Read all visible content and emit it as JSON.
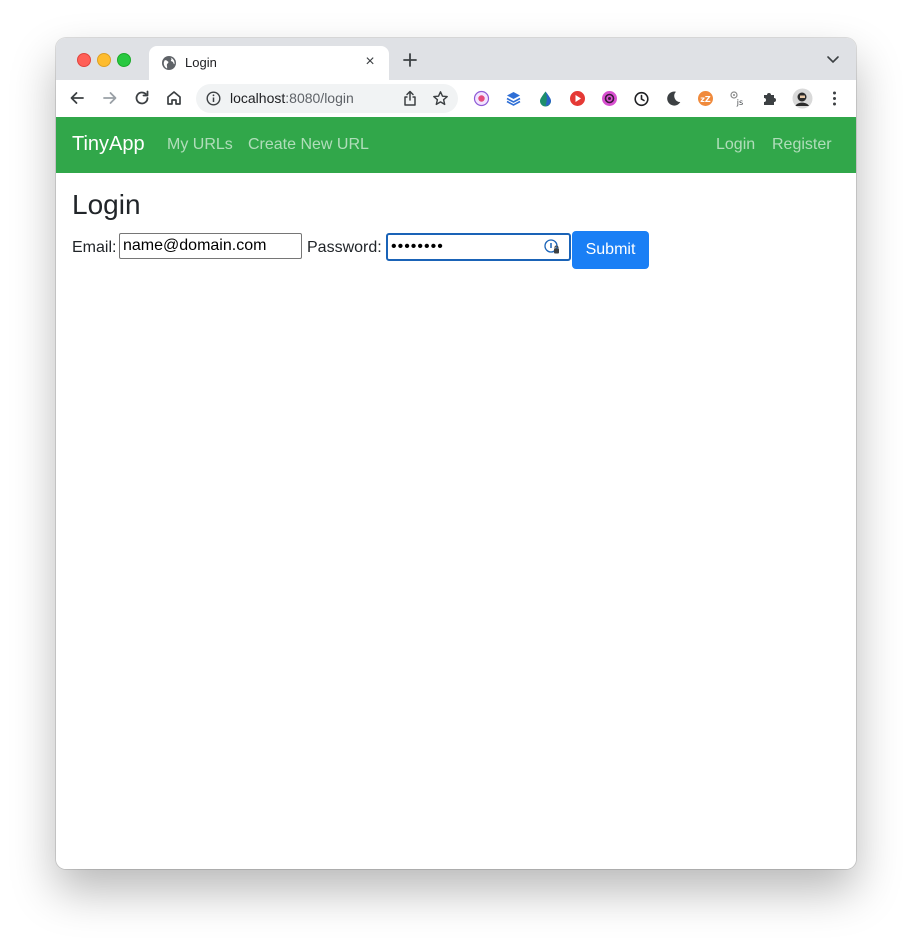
{
  "browser": {
    "tab": {
      "title": "Login",
      "favicon": "globe-icon",
      "close_label": "×"
    },
    "address_bar": {
      "host": "localhost",
      "path": ":8080/login"
    },
    "icons": [
      "back-arrow-icon",
      "forward-arrow-icon",
      "reload-icon",
      "home-icon",
      "site-info-icon",
      "share-icon",
      "bookmark-star-icon",
      "extensions-puzzle-icon",
      "profile-avatar-icon",
      "more-menu-icon"
    ],
    "extensions": [
      "extension-1-icon",
      "extension-2-icon",
      "extension-3-icon",
      "extension-4-icon",
      "extension-5-icon",
      "extension-6-icon",
      "extension-7-icon",
      "extension-8-icon",
      "extension-9-icon"
    ]
  },
  "navbar": {
    "brand": "TinyApp",
    "links": [
      "My URLs",
      "Create New URL"
    ],
    "right_links": [
      "Login",
      "Register"
    ],
    "background_color": "#31a74a"
  },
  "page": {
    "title": "Login",
    "email_label": "Email:",
    "email_value": "name@domain.com",
    "password_label": "Password:",
    "password_value": "••••••••",
    "submit_label": "Submit",
    "submit_color": "#1a7ff5"
  }
}
